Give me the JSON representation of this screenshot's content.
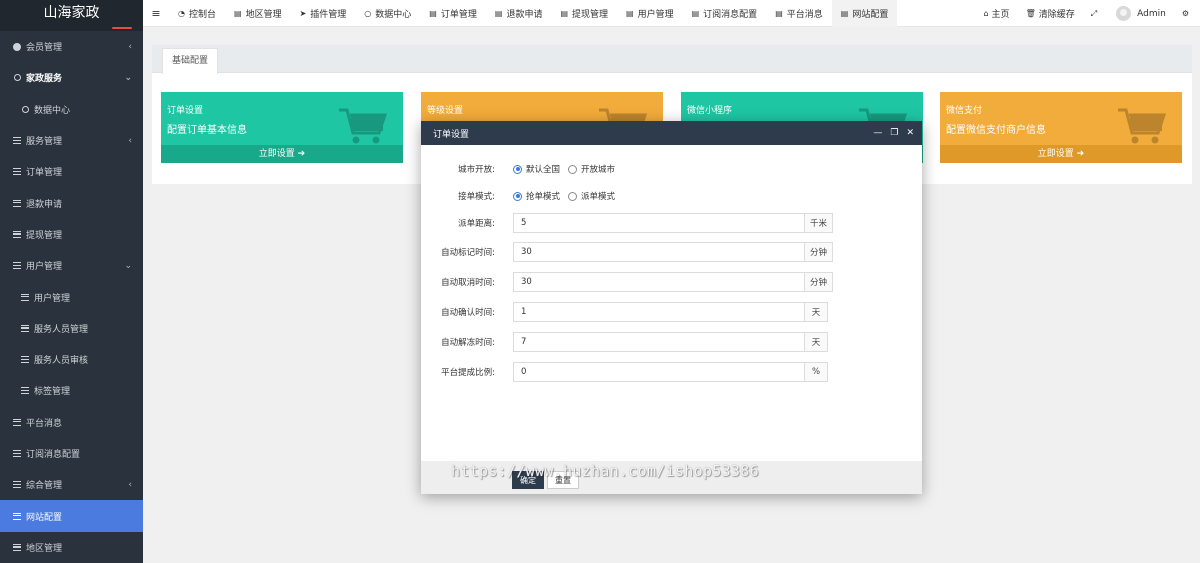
{
  "sidebar": {
    "logo": "山海家政",
    "items": [
      {
        "label": "会员管理",
        "icon": "person-icon",
        "arrow": "‹"
      },
      {
        "label": "家政服务",
        "icon": "circle-icon",
        "arrow": "⌄"
      },
      {
        "label": "数据中心",
        "icon": "circle-icon",
        "arrow": ""
      },
      {
        "label": "服务管理",
        "icon": "list-icon",
        "arrow": "‹"
      },
      {
        "label": "订单管理",
        "icon": "list-icon",
        "arrow": ""
      },
      {
        "label": "退款申请",
        "icon": "list-icon",
        "arrow": ""
      },
      {
        "label": "提现管理",
        "icon": "list-icon",
        "arrow": ""
      },
      {
        "label": "用户管理",
        "icon": "list-icon",
        "arrow": "⌄"
      },
      {
        "label": "用户管理",
        "icon": "list-icon",
        "arrow": ""
      },
      {
        "label": "服务人员管理",
        "icon": "list-icon",
        "arrow": ""
      },
      {
        "label": "服务人员审核",
        "icon": "list-icon",
        "arrow": ""
      },
      {
        "label": "标签管理",
        "icon": "list-icon",
        "arrow": ""
      },
      {
        "label": "平台消息",
        "icon": "list-icon",
        "arrow": ""
      },
      {
        "label": "订阅消息配置",
        "icon": "list-icon",
        "arrow": ""
      },
      {
        "label": "综合管理",
        "icon": "list-icon",
        "arrow": "‹"
      },
      {
        "label": "网站配置",
        "icon": "list-icon",
        "arrow": ""
      },
      {
        "label": "地区管理",
        "icon": "list-icon",
        "arrow": ""
      }
    ]
  },
  "topbar": {
    "menu_icon": "≡",
    "tabs": [
      "控制台",
      "地区管理",
      "插件管理",
      "数据中心",
      "订单管理",
      "退款申请",
      "提现管理",
      "用户管理",
      "订阅消息配置",
      "平台消息",
      "网站配置"
    ],
    "home": "主页",
    "clear_cache": "清除缓存",
    "user": "Admin"
  },
  "content": {
    "tab": "基础配置",
    "cards": [
      {
        "title": "订单设置",
        "subtitle": "配置订单基本信息",
        "action": "立即设置",
        "color": "#1fc6a4"
      },
      {
        "title": "等级设置",
        "subtitle": "",
        "action": "",
        "color": "#f2ac3b"
      },
      {
        "title": "微信小程序",
        "subtitle": "",
        "action": "",
        "color": "#1fc6a4"
      },
      {
        "title": "微信支付",
        "subtitle": "配置微信支付商户信息",
        "action": "立即设置",
        "color": "#f2ac3b"
      }
    ]
  },
  "modal": {
    "title": "订单设置",
    "city_open": {
      "label": "城市开放:",
      "options": [
        "默认全国",
        "开放城市"
      ],
      "selected": 0
    },
    "dispatch_mode": {
      "label": "接单模式:",
      "options": [
        "抢单模式",
        "派单模式"
      ],
      "selected": 0
    },
    "fields": [
      {
        "label": "派单距离:",
        "value": "5",
        "unit": "千米"
      },
      {
        "label": "自动标记时间:",
        "value": "30",
        "unit": "分钟"
      },
      {
        "label": "自动取消时间:",
        "value": "30",
        "unit": "分钟"
      },
      {
        "label": "自动确认时间:",
        "value": "1",
        "unit": "天"
      },
      {
        "label": "自动解冻时间:",
        "value": "7",
        "unit": "天"
      },
      {
        "label": "平台提成比例:",
        "value": "0",
        "unit": "%"
      }
    ],
    "ok": "确定",
    "reset": "重置"
  },
  "watermark": "https://www.huzhan.com/ishop53386"
}
